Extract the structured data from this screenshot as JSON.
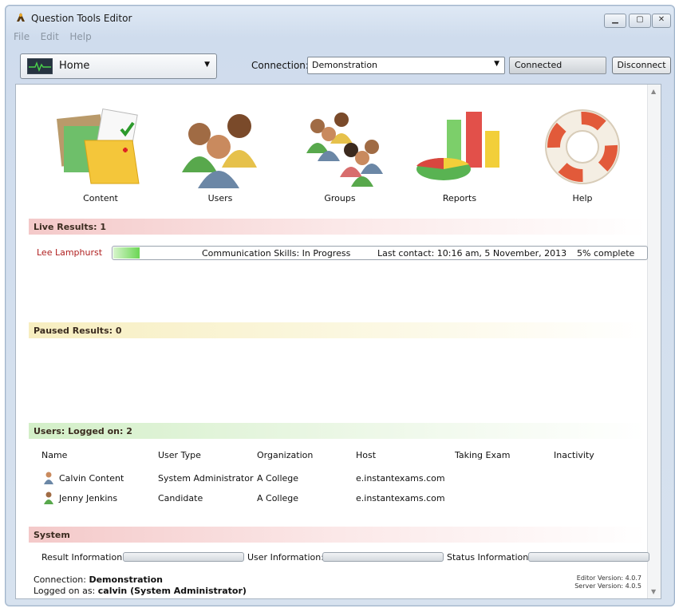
{
  "window": {
    "title": "Question Tools Editor"
  },
  "menu": [
    "File",
    "Edit",
    "Help"
  ],
  "toolbar": {
    "home_label": "Home",
    "connection_label": "Connection:",
    "connection_value": "Demonstration",
    "status": "Connected",
    "disconnect_label": "Disconnect"
  },
  "tiles": [
    {
      "label": "Content",
      "icon": "content-folder-icon"
    },
    {
      "label": "Users",
      "icon": "users-icon"
    },
    {
      "label": "Groups",
      "icon": "groups-icon"
    },
    {
      "label": "Reports",
      "icon": "reports-chart-icon"
    },
    {
      "label": "Help",
      "icon": "lifebuoy-icon"
    }
  ],
  "live": {
    "heading": "Live Results: 1",
    "rows": [
      {
        "name": "Lee Lamphurst",
        "exam": "Communication Skills: In Progress",
        "last_contact": "Last contact: 10:16 am, 5 November, 2013",
        "complete": "5%  complete",
        "progress": 0.05
      }
    ]
  },
  "paused": {
    "heading": "Paused Results: 0"
  },
  "users": {
    "heading": "Users:   Logged on: 2",
    "columns": [
      "Name",
      "User Type",
      "Organization",
      "Host",
      "Taking Exam",
      "Inactivity"
    ],
    "rows": [
      {
        "name": "Calvin Content",
        "type": "System Administrator",
        "org": "A College",
        "host": "e.instantexams.com",
        "exam": "",
        "inactivity": ""
      },
      {
        "name": "Jenny Jenkins",
        "type": "Candidate",
        "org": "A College",
        "host": "e.instantexams.com",
        "exam": "",
        "inactivity": ""
      }
    ]
  },
  "system": {
    "heading": "System",
    "result_info": "Result Information:",
    "user_info": "User Information:",
    "status_info": "Status Information:"
  },
  "footer": {
    "connection_label": "Connection:",
    "connection_value": "Demonstration",
    "logged_label": "Logged on as:",
    "logged_value": "calvin (System Administrator)",
    "editor_version": "Editor Version: 4.0.7",
    "server_version": "Server Version: 4.0.5"
  }
}
